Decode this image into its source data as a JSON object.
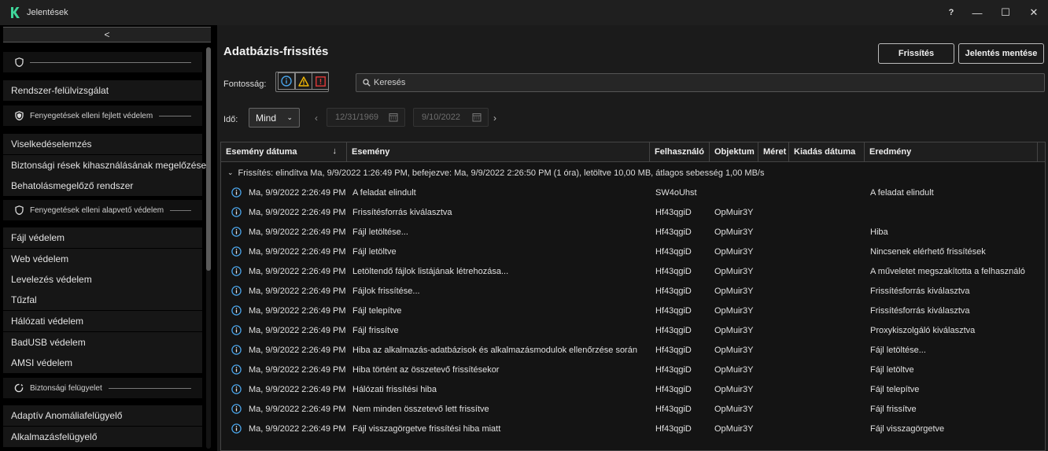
{
  "window": {
    "title": "Jelentések",
    "help": "?",
    "minimize": "—",
    "maximize": "☐",
    "close": "✕"
  },
  "sidebar": {
    "collapse": "<",
    "sections": [
      {
        "label": "",
        "icon": "shield-outline-icon",
        "items": [
          "Rendszer-felülvizsgálat"
        ]
      },
      {
        "label": "Fenyegetések elleni fejlett védelem",
        "icon": "shield-filled-icon",
        "items": [
          "Viselkedéselemzés",
          "Biztonsági rések kihasználásának megelőzése",
          "Behatolásmegelőző rendszer"
        ]
      },
      {
        "label": "Fenyegetések elleni alapvető védelem",
        "icon": "shield-outline-icon",
        "items": [
          "Fájl védelem",
          "Web védelem",
          "Levelezés védelem",
          "Tűzfal",
          "Hálózati védelem",
          "BadUSB védelem",
          "AMSI védelem"
        ]
      },
      {
        "label": "Biztonsági felügyelet",
        "icon": "shield-check-icon",
        "items": [
          "Adaptív Anomáliafelügyelő",
          "Alkalmazásfelügyelő"
        ]
      }
    ]
  },
  "main": {
    "title": "Adatbázis-frissítés",
    "refresh_button": "Frissítés",
    "save_button": "Jelentés mentése",
    "importance_label": "Fontosság:",
    "search_placeholder": "Keresés",
    "time_label": "Idő:",
    "time_select": "Mind",
    "date_from": "12/31/1969",
    "date_to": "9/10/2022",
    "colors": {
      "info": "#4aa3e8",
      "warning": "#f2b705",
      "critical": "#e03a3a"
    }
  },
  "table": {
    "columns": [
      "Esemény dátuma",
      "Esemény",
      "Felhasználó",
      "Objektum",
      "Méret",
      "Kiadás dátuma",
      "Eredmény"
    ],
    "sort_indicator": "↓",
    "group": "Frissítés: elindítva Ma, 9/9/2022 1:26:49 PM, befejezve: Ma, 9/9/2022 2:26:50 PM (1 óra), letöltve 10,00 MB, átlagos sebesség 1,00 MB/s",
    "rows": [
      {
        "date": "Ma, 9/9/2022 2:26:49 PM",
        "event": "A feladat elindult",
        "user": "SW4oUhst",
        "object": "",
        "result": "A feladat elindult"
      },
      {
        "date": "Ma, 9/9/2022 2:26:49 PM",
        "event": "Frissítésforrás kiválasztva",
        "user": "Hf43qgiD",
        "object": "OpMuir3Y",
        "result": ""
      },
      {
        "date": "Ma, 9/9/2022 2:26:49 PM",
        "event": "Fájl letöltése...",
        "user": "Hf43qgiD",
        "object": "OpMuir3Y",
        "result": "Hiba"
      },
      {
        "date": "Ma, 9/9/2022 2:26:49 PM",
        "event": "Fájl letöltve",
        "user": "Hf43qgiD",
        "object": "OpMuir3Y",
        "result": "Nincsenek elérhető frissítések"
      },
      {
        "date": "Ma, 9/9/2022 2:26:49 PM",
        "event": "Letöltendő fájlok listájának létrehozása...",
        "user": "Hf43qgiD",
        "object": "OpMuir3Y",
        "result": "A műveletet megszakította a felhasználó"
      },
      {
        "date": "Ma, 9/9/2022 2:26:49 PM",
        "event": "Fájlok frissítése...",
        "user": "Hf43qgiD",
        "object": "OpMuir3Y",
        "result": "Frissítésforrás kiválasztva"
      },
      {
        "date": "Ma, 9/9/2022 2:26:49 PM",
        "event": "Fájl telepítve",
        "user": "Hf43qgiD",
        "object": "OpMuir3Y",
        "result": "Frissítésforrás kiválasztva"
      },
      {
        "date": "Ma, 9/9/2022 2:26:49 PM",
        "event": "Fájl frissítve",
        "user": "Hf43qgiD",
        "object": "OpMuir3Y",
        "result": "Proxykiszolgáló kiválasztva"
      },
      {
        "date": "Ma, 9/9/2022 2:26:49 PM",
        "event": "Hiba az alkalmazás-adatbázisok és alkalmazásmodulok ellenőrzése során",
        "user": "Hf43qgiD",
        "object": "OpMuir3Y",
        "result": "Fájl letöltése..."
      },
      {
        "date": "Ma, 9/9/2022 2:26:49 PM",
        "event": "Hiba történt az összetevő frissítésekor",
        "user": "Hf43qgiD",
        "object": "OpMuir3Y",
        "result": "Fájl letöltve"
      },
      {
        "date": "Ma, 9/9/2022 2:26:49 PM",
        "event": "Hálózati frissítési hiba",
        "user": "Hf43qgiD",
        "object": "OpMuir3Y",
        "result": "Fájl telepítve"
      },
      {
        "date": "Ma, 9/9/2022 2:26:49 PM",
        "event": "Nem minden összetevő lett frissítve",
        "user": "Hf43qgiD",
        "object": "OpMuir3Y",
        "result": "Fájl frissítve"
      },
      {
        "date": "Ma, 9/9/2022 2:26:49 PM",
        "event": "Fájl visszagörgetve frissítési hiba miatt",
        "user": "Hf43qgiD",
        "object": "OpMuir3Y",
        "result": "Fájl visszagörgetve"
      }
    ]
  }
}
